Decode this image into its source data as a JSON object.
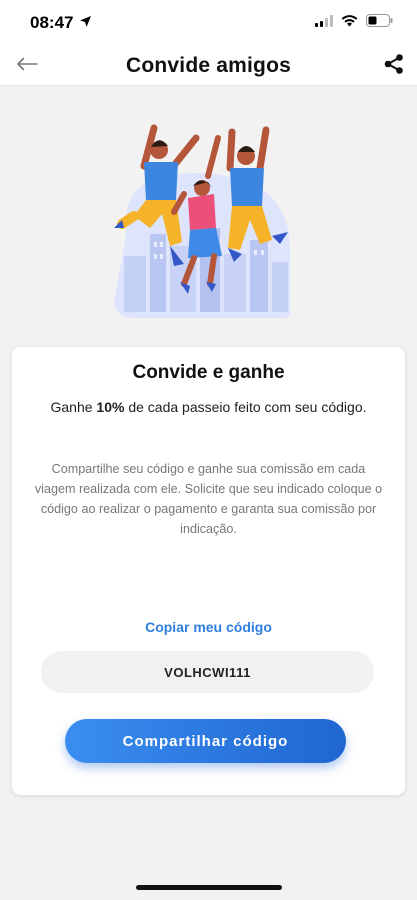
{
  "status_bar": {
    "time": "08:47",
    "icons": [
      "location-arrow-icon",
      "cellular-signal-icon",
      "wifi-icon",
      "battery-icon"
    ]
  },
  "header": {
    "title": "Convide amigos",
    "back_icon": "arrow-left-icon",
    "share_icon": "share-icon"
  },
  "illustration": {
    "icon": "friends-jumping-illustration"
  },
  "card": {
    "title": "Convide e ganhe",
    "subtitle_prefix": "Ganhe ",
    "subtitle_highlight": "10%",
    "subtitle_suffix": " de cada passeio feito com seu código.",
    "description": "Compartilhe seu código e ganhe sua comissão em cada viagem realizada com ele. Solicite que seu indicado coloque o código ao realizar o pagamento e garanta sua comissão por indicação.",
    "copy_link": "Copiar meu código",
    "code": "VOLHCWI111",
    "share_button": "Compartilhar código"
  },
  "colors": {
    "accent": "#2f7fe0",
    "button_gradient_start": "#3b8ef0",
    "button_gradient_end": "#1f66d1",
    "background": "#f2f2f2"
  }
}
